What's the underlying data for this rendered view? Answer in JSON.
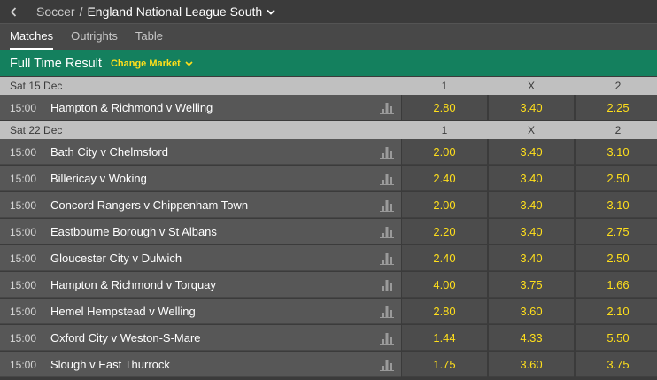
{
  "breadcrumb": {
    "sport": "Soccer",
    "separator": "/",
    "league": "England National League South"
  },
  "tabs": [
    "Matches",
    "Outrights",
    "Table"
  ],
  "market": {
    "title": "Full Time Result",
    "change_label": "Change Market"
  },
  "columns": [
    "1",
    "X",
    "2"
  ],
  "days": [
    {
      "date": "Sat 15 Dec",
      "matches": [
        {
          "time": "15:00",
          "teams": "Hampton & Richmond v Welling",
          "odds": [
            "2.80",
            "3.40",
            "2.25"
          ]
        }
      ]
    },
    {
      "date": "Sat 22 Dec",
      "matches": [
        {
          "time": "15:00",
          "teams": "Bath City v Chelmsford",
          "odds": [
            "2.00",
            "3.40",
            "3.10"
          ]
        },
        {
          "time": "15:00",
          "teams": "Billericay v Woking",
          "odds": [
            "2.40",
            "3.40",
            "2.50"
          ]
        },
        {
          "time": "15:00",
          "teams": "Concord Rangers v Chippenham Town",
          "odds": [
            "2.00",
            "3.40",
            "3.10"
          ]
        },
        {
          "time": "15:00",
          "teams": "Eastbourne Borough v St Albans",
          "odds": [
            "2.20",
            "3.40",
            "2.75"
          ]
        },
        {
          "time": "15:00",
          "teams": "Gloucester City v Dulwich",
          "odds": [
            "2.40",
            "3.40",
            "2.50"
          ]
        },
        {
          "time": "15:00",
          "teams": "Hampton & Richmond v Torquay",
          "odds": [
            "4.00",
            "3.75",
            "1.66"
          ]
        },
        {
          "time": "15:00",
          "teams": "Hemel Hempstead v Welling",
          "odds": [
            "2.80",
            "3.60",
            "2.10"
          ]
        },
        {
          "time": "15:00",
          "teams": "Oxford City v Weston-S-Mare",
          "odds": [
            "1.44",
            "4.33",
            "5.50"
          ]
        },
        {
          "time": "15:00",
          "teams": "Slough v East Thurrock",
          "odds": [
            "1.75",
            "3.60",
            "3.75"
          ]
        }
      ]
    }
  ],
  "icons": {
    "back": "chevron-left-icon",
    "league_menu": "chevron-down-icon",
    "change_market": "chevron-down-icon",
    "stats": "bar-chart-icon"
  },
  "colors": {
    "market_bar": "#14805e",
    "odds_text": "#ffdf1b",
    "day_header": "#c0c0c0"
  }
}
